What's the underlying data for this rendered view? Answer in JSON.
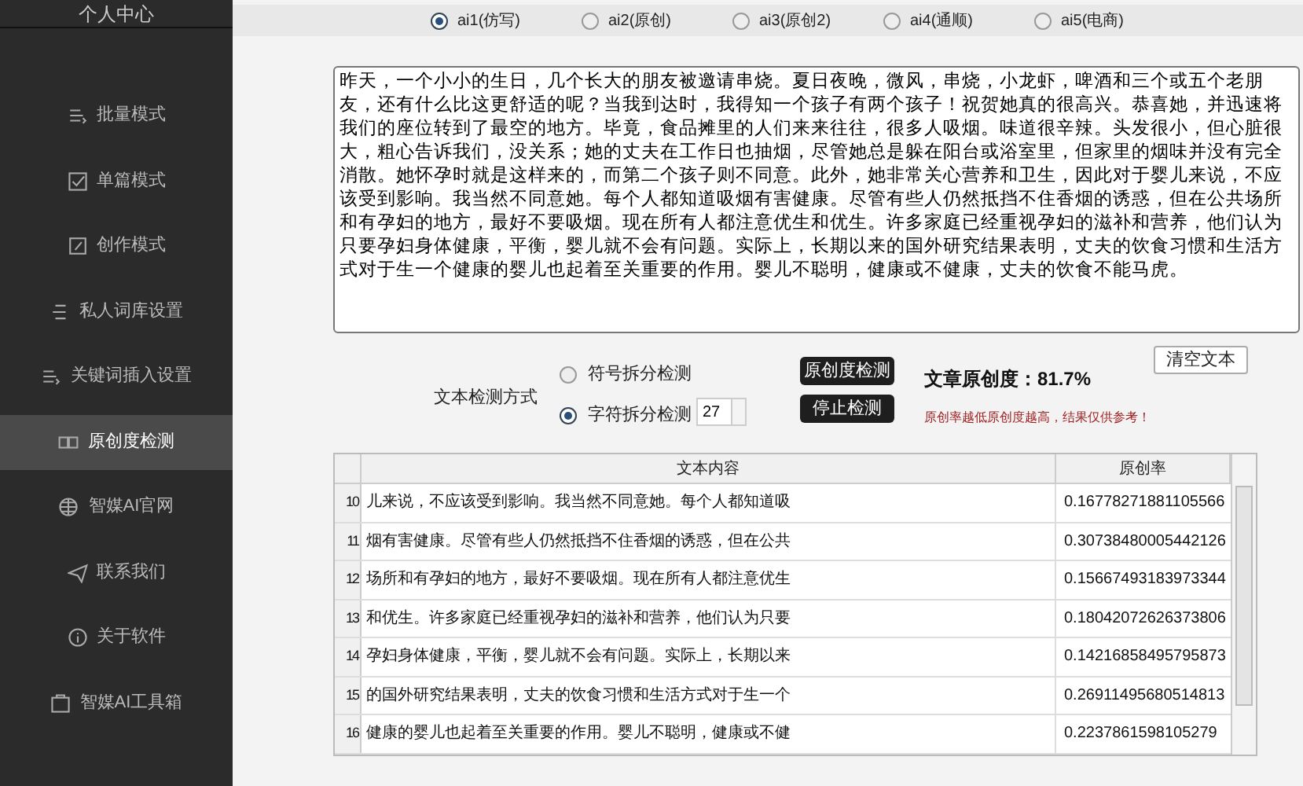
{
  "sidebar": {
    "header": "个人中心",
    "items": [
      {
        "label": "批量模式",
        "selected": false
      },
      {
        "label": "单篇模式",
        "selected": false
      },
      {
        "label": "创作模式",
        "selected": false
      },
      {
        "label": "私人词库设置",
        "selected": false
      },
      {
        "label": "关键词插入设置",
        "selected": false
      },
      {
        "label": "原创度检测",
        "selected": true
      },
      {
        "label": "智媒AI官网",
        "selected": false
      },
      {
        "label": "联系我们",
        "selected": false
      },
      {
        "label": "关于软件",
        "selected": false
      },
      {
        "label": "智媒AI工具箱",
        "selected": false
      }
    ]
  },
  "modes": [
    {
      "label": "ai1(仿写)",
      "selected": true
    },
    {
      "label": "ai2(原创)",
      "selected": false
    },
    {
      "label": "ai3(原创2)",
      "selected": false
    },
    {
      "label": "ai4(通顺)",
      "selected": false
    },
    {
      "label": "ai5(电商)",
      "selected": false
    }
  ],
  "text_area": {
    "value": "昨天，一个小小的生日，几个长大的朋友被邀请串烧。夏日夜晚，微风，串烧，小龙虾，啤酒和三个或五个老朋友，还有什么比这更舒适的呢？当我到达时，我得知一个孩子有两个孩子！祝贺她真的很高兴。恭喜她，并迅速将我们的座位转到了最空的地方。毕竟，食品摊里的人们来来往往，很多人吸烟。味道很辛辣。头发很小，但心脏很大，粗心告诉我们，没关系；她的丈夫在工作日也抽烟，尽管她总是躲在阳台或浴室里，但家里的烟味并没有完全消散。她怀孕时就是这样来的，而第二个孩子则不同意。此外，她非常关心营养和卫生，因此对于婴儿来说，不应该受到影响。我当然不同意她。每个人都知道吸烟有害健康。尽管有些人仍然抵挡不住香烟的诱惑，但在公共场所和有孕妇的地方，最好不要吸烟。现在所有人都注意优生和优生。许多家庭已经重视孕妇的滋补和营养，他们认为只要孕妇身体健康，平衡，婴儿就不会有问题。实际上，长期以来的国外研究结果表明，丈夫的饮食习惯和生活方式对于生一个健康的婴儿也起着至关重要的作用。婴儿不聪明，健康或不健康，丈夫的饮食不能马虎。"
  },
  "detect_method": {
    "label": "文本检测方式",
    "options": [
      {
        "label": "符号拆分检测",
        "selected": false
      },
      {
        "label": "字符拆分检测",
        "selected": true
      }
    ],
    "char_count": "27"
  },
  "buttons": [
    {
      "label": "原创度检测"
    },
    {
      "label": "停止检测"
    }
  ],
  "clear_button": "清空文本",
  "result": "文章原创度：81.7%",
  "note": "原创率越低原创度越高，结果仅供参考！",
  "table": {
    "columns": [
      "文本内容",
      "原创率"
    ],
    "rows": [
      {
        "index": "10",
        "text": "儿来说，不应该受到影响。我当然不同意她。每个人都知道吸",
        "rate": "0.16778271881105566"
      },
      {
        "index": "11",
        "text": "烟有害健康。尽管有些人仍然抵挡不住香烟的诱惑，但在公共",
        "rate": "0.30738480005442126"
      },
      {
        "index": "12",
        "text": "场所和有孕妇的地方，最好不要吸烟。现在所有人都注意优生",
        "rate": "0.15667493183973344"
      },
      {
        "index": "13",
        "text": "和优生。许多家庭已经重视孕妇的滋补和营养，他们认为只要",
        "rate": "0.18042072626373806"
      },
      {
        "index": "14",
        "text": "孕妇身体健康，平衡，婴儿就不会有问题。实际上，长期以来",
        "rate": "0.14216858495795873"
      },
      {
        "index": "15",
        "text": "的国外研究结果表明，丈夫的饮食习惯和生活方式对于生一个",
        "rate": "0.26911495680514813"
      },
      {
        "index": "16",
        "text": "健康的婴儿也起着至关重要的作用。婴儿不聪明，健康或不健",
        "rate": "0.2237861598105279"
      }
    ]
  }
}
